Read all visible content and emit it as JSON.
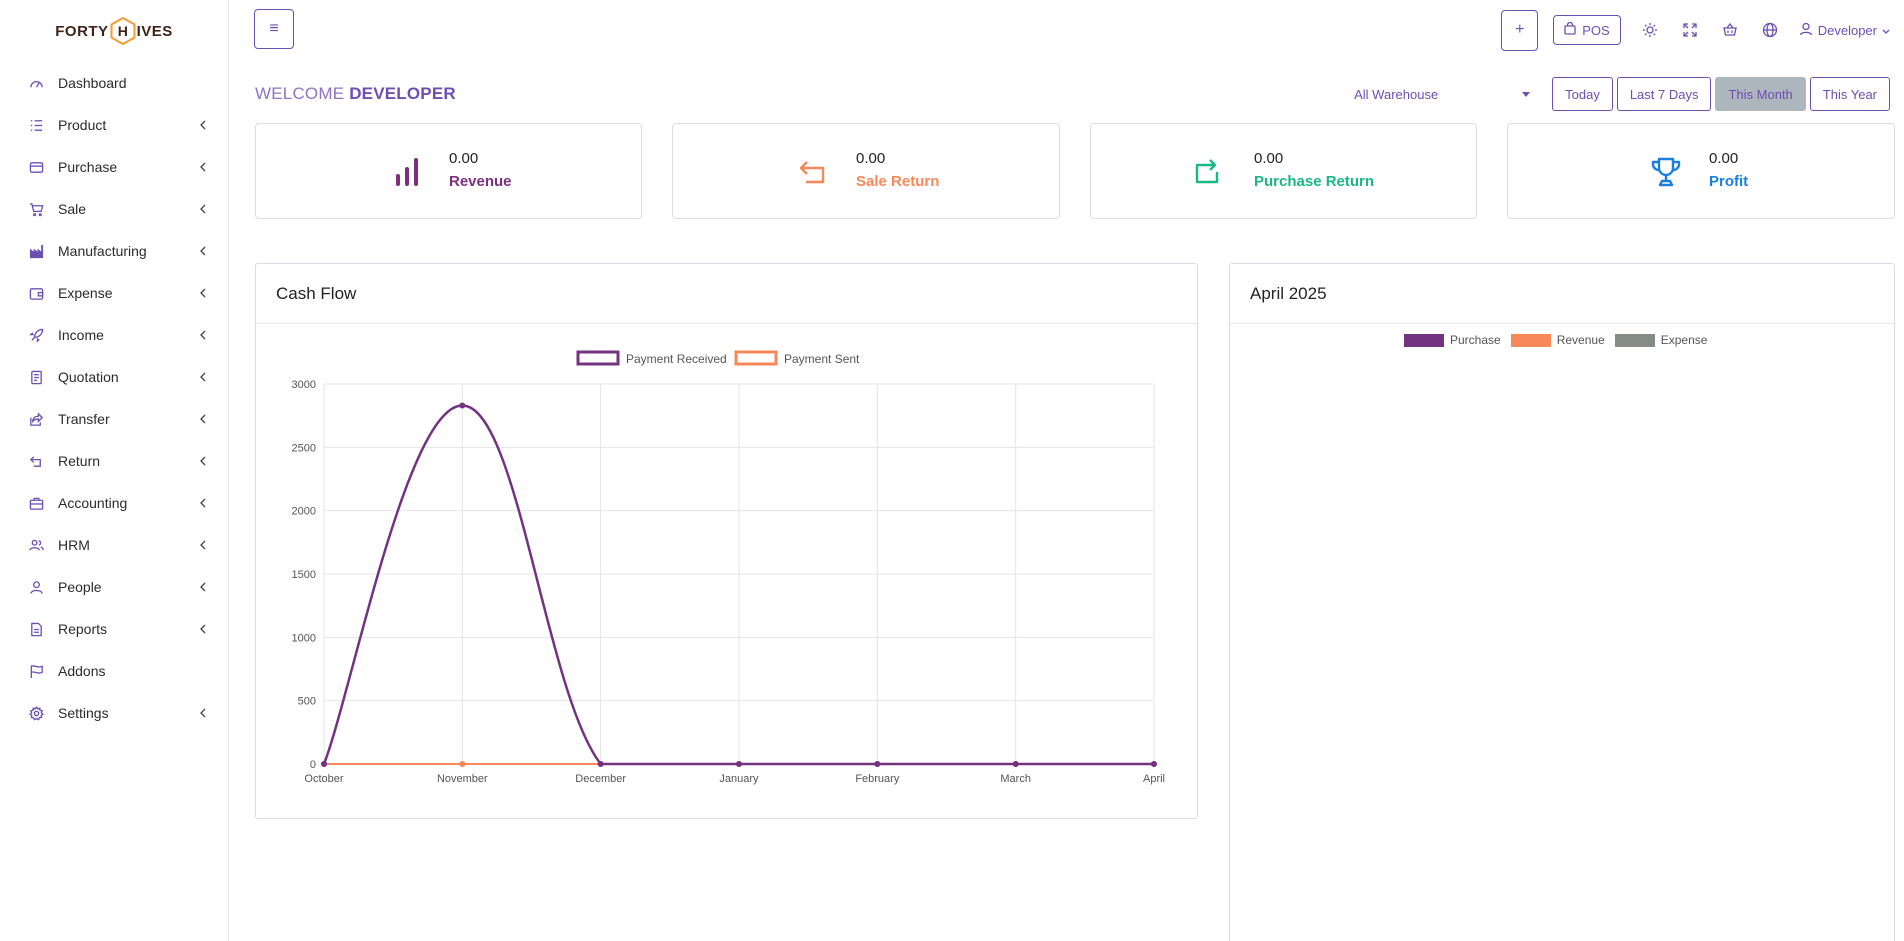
{
  "brand": {
    "left": "FORTY",
    "middle": "I",
    "right": "VES",
    "accent": "#f39c33"
  },
  "sidebar": {
    "items": [
      {
        "label": "Dashboard",
        "icon": "gauge-icon",
        "expandable": false
      },
      {
        "label": "Product",
        "icon": "list-icon",
        "expandable": true
      },
      {
        "label": "Purchase",
        "icon": "credit-card-icon",
        "expandable": true
      },
      {
        "label": "Sale",
        "icon": "cart-icon",
        "expandable": true
      },
      {
        "label": "Manufacturing",
        "icon": "factory-icon",
        "expandable": true
      },
      {
        "label": "Expense",
        "icon": "wallet-icon",
        "expandable": true
      },
      {
        "label": "Income",
        "icon": "rocket-icon",
        "expandable": true
      },
      {
        "label": "Quotation",
        "icon": "document-icon",
        "expandable": true
      },
      {
        "label": "Transfer",
        "icon": "share-icon",
        "expandable": true
      },
      {
        "label": "Return",
        "icon": "return-icon",
        "expandable": true
      },
      {
        "label": "Accounting",
        "icon": "briefcase-icon",
        "expandable": true
      },
      {
        "label": "HRM",
        "icon": "users-icon",
        "expandable": true
      },
      {
        "label": "People",
        "icon": "user-icon",
        "expandable": true
      },
      {
        "label": "Reports",
        "icon": "file-icon",
        "expandable": true
      },
      {
        "label": "Addons",
        "icon": "flag-icon",
        "expandable": false
      },
      {
        "label": "Settings",
        "icon": "gear-icon",
        "expandable": true
      }
    ]
  },
  "header": {
    "menu_icon": "≡",
    "add_label": "+",
    "pos_label": "POS",
    "user_label": "Developer"
  },
  "welcome": {
    "prefix": "WELCOME",
    "name": "DEVELOPER"
  },
  "filters": {
    "warehouse": "All Warehouse",
    "ranges": [
      "Today",
      "Last 7 Days",
      "This Month",
      "This Year"
    ],
    "active": "This Month"
  },
  "stats": [
    {
      "value": "0.00",
      "label": "Revenue",
      "color": "#7b2f7d",
      "icon": "bar-chart-icon"
    },
    {
      "value": "0.00",
      "label": "Sale Return",
      "color": "#f7885a",
      "icon": "return-arrow-icon"
    },
    {
      "value": "0.00",
      "label": "Purchase Return",
      "color": "#19b882",
      "icon": "refresh-square-icon"
    },
    {
      "value": "0.00",
      "label": "Profit",
      "color": "#1b7fe0",
      "icon": "trophy-icon"
    }
  ],
  "cashflow": {
    "title": "Cash Flow"
  },
  "monthly": {
    "title": "April 2025"
  },
  "chart_data": [
    {
      "type": "line",
      "title": "Cash Flow",
      "categories": [
        "October",
        "November",
        "December",
        "January",
        "February",
        "March",
        "April"
      ],
      "series": [
        {
          "name": "Payment Received",
          "color": "#733381",
          "values": [
            0,
            2830,
            0,
            0,
            0,
            0,
            0
          ]
        },
        {
          "name": "Payment Sent",
          "color": "#f7885a",
          "values": [
            0,
            0,
            0,
            0,
            0,
            0,
            0
          ]
        }
      ],
      "ylim": [
        0,
        3000
      ],
      "yticks": [
        0,
        500,
        1000,
        1500,
        2000,
        2500,
        3000
      ],
      "legend": "top",
      "grid": true
    },
    {
      "type": "pie",
      "title": "April 2025",
      "series": [
        {
          "name": "Purchase",
          "color": "#733381",
          "values": [
            0
          ]
        },
        {
          "name": "Revenue",
          "color": "#f7885a",
          "values": [
            0
          ]
        },
        {
          "name": "Expense",
          "color": "#858c85",
          "values": [
            0
          ]
        }
      ],
      "legend": "top"
    }
  ]
}
